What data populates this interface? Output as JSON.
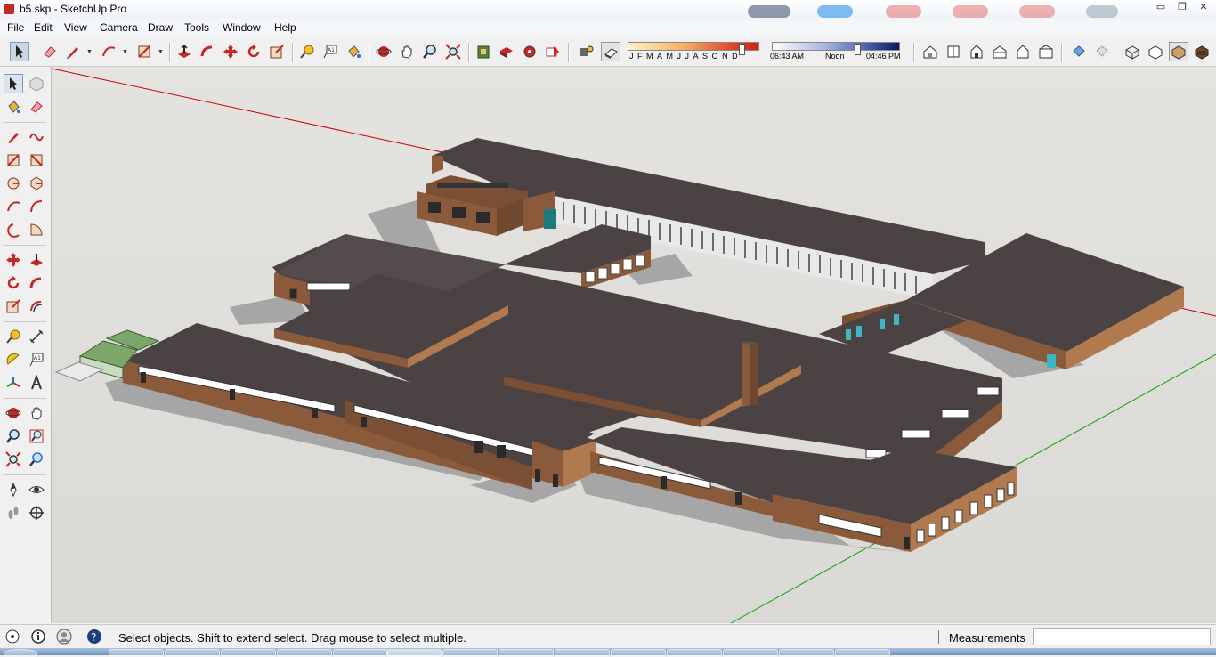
{
  "window": {
    "title": "b5.skp - SketchUp Pro"
  },
  "menu": [
    "File",
    "Edit",
    "View",
    "Camera",
    "Draw",
    "Tools",
    "Window",
    "Help"
  ],
  "shadow_settings": {
    "months": [
      "J",
      "F",
      "M",
      "A",
      "M",
      "J",
      "J",
      "A",
      "S",
      "O",
      "N",
      "D"
    ],
    "time_start": "06:43 AM",
    "time_noon": "Noon",
    "time_end": "04:46 PM"
  },
  "status": {
    "message": "Select objects. Shift to extend select. Drag mouse to select multiple.",
    "measurements_label": "Measurements",
    "measurements_value": ""
  },
  "colors": {
    "roof": "#4a4243",
    "wall": "#8a5a3a",
    "wall_dark": "#6f4830",
    "ground_shadow": "#a3a3a3",
    "axis_red": "#cc0000",
    "axis_green": "#0aa00a"
  }
}
